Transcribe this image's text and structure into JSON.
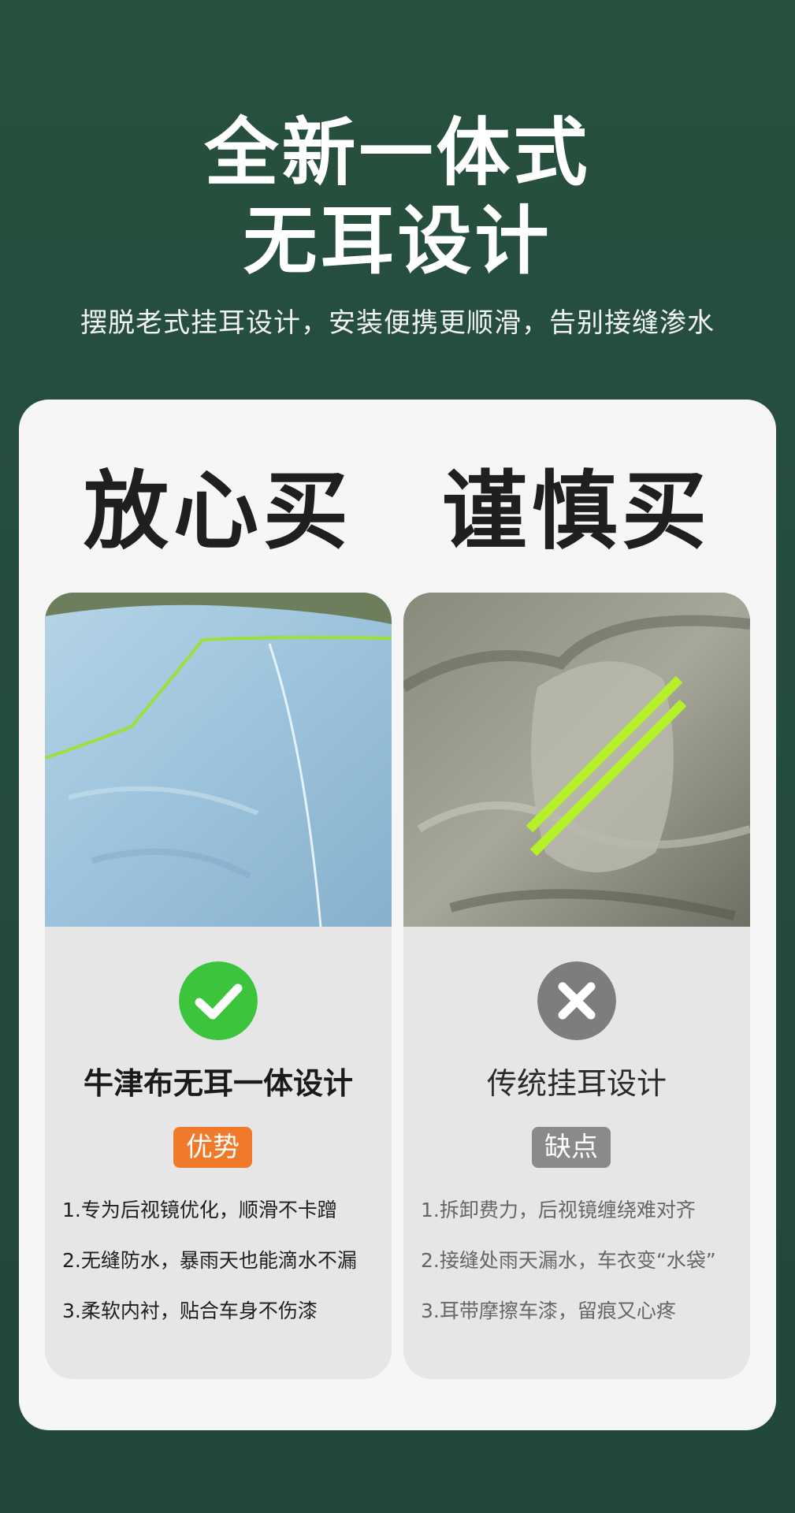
{
  "headline": {
    "line1": "全新一体式",
    "line2": "无耳设计",
    "subtitle": "摆脱老式挂耳设计，安装便携更顺滑，告别接缝渗水"
  },
  "left": {
    "title": "放心买",
    "product": "牛津布无耳一体设计",
    "tag": "优势",
    "icon": "check-icon",
    "accent": "#3cc53c",
    "points": [
      "1.专为后视镜优化，顺滑不卡蹭",
      "2.无缝防水，暴雨天也能滴水不漏",
      "3.柔软内衬，贴合车身不伤漆"
    ]
  },
  "right": {
    "title": "谨慎买",
    "product": "传统挂耳设计",
    "tag": "缺点",
    "icon": "cross-icon",
    "accent": "#7d7d7d",
    "points": [
      "1.拆卸费力，后视镜缠绕难对齐",
      "2.接缝处雨天漏水，车衣变“水袋”",
      "3.耳带摩擦车漆，留痕又心疼"
    ]
  },
  "colors": {
    "background": "#244a3b",
    "panel": "#f6f6f6",
    "card": "#e6e6e6",
    "advantage_tag": "#f07a2a",
    "disadvantage_tag": "#8a8a8a"
  }
}
